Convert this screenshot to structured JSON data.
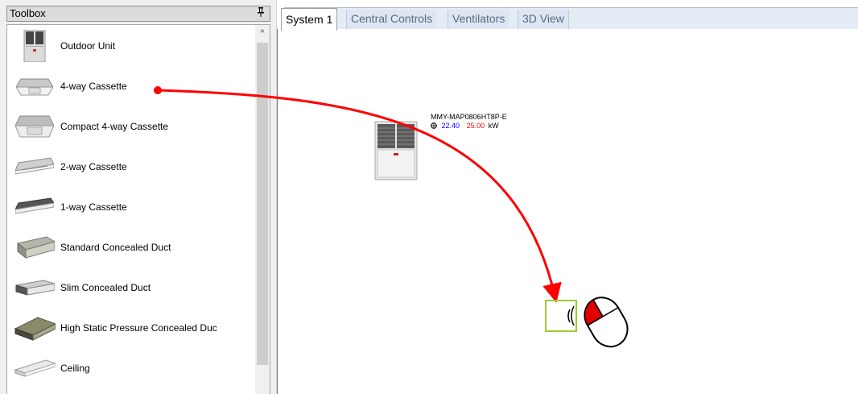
{
  "toolbox": {
    "title": "Toolbox",
    "pin_glyph": "Ͱ",
    "scroll_up_glyph": "^",
    "items": [
      {
        "label": "Outdoor Unit",
        "icon": "outdoor-unit-icon"
      },
      {
        "label": "4-way Cassette",
        "icon": "4-way-cassette-icon"
      },
      {
        "label": "Compact 4-way Cassette",
        "icon": "compact-4-way-cassette-icon"
      },
      {
        "label": "2-way Cassette",
        "icon": "2-way-cassette-icon"
      },
      {
        "label": "1-way Cassette",
        "icon": "1-way-cassette-icon"
      },
      {
        "label": "Standard Concealed Duct",
        "icon": "standard-duct-icon"
      },
      {
        "label": "Slim Concealed Duct",
        "icon": "slim-duct-icon"
      },
      {
        "label": "High Static Pressure Concealed Duc",
        "icon": "high-static-duct-icon"
      },
      {
        "label": "Ceiling",
        "icon": "ceiling-icon"
      }
    ]
  },
  "tabs": [
    {
      "label": "System 1",
      "active": true
    },
    {
      "label": "Central Controls",
      "active": false
    },
    {
      "label": "Ventilators",
      "active": false
    },
    {
      "label": "3D View",
      "active": false
    }
  ],
  "canvas": {
    "unit": {
      "model": "MMY-MAP0806HT8P-E",
      "cooling_kw": "22.40",
      "heating_kw": "25.00",
      "unit": "kW"
    }
  },
  "colors": {
    "drag_arrow": "#ff0000",
    "drop_box": "#9acd32",
    "mouse_button": "#e00000"
  }
}
